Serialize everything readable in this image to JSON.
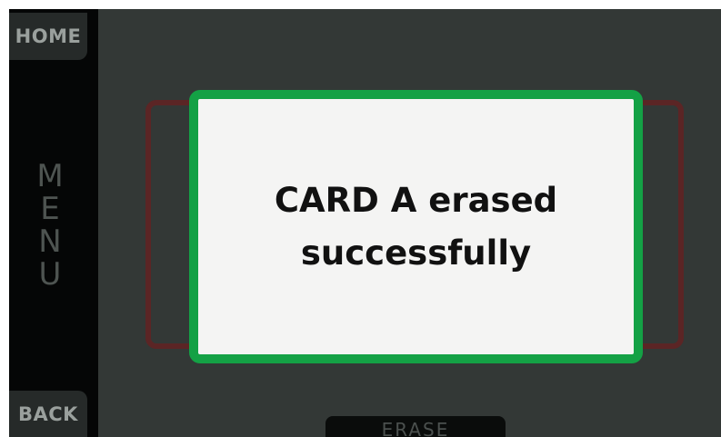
{
  "sidebar": {
    "home_label": "HOME",
    "menu_letters": [
      "M",
      "E",
      "N",
      "U"
    ],
    "back_label": "BACK"
  },
  "background": {
    "erase_label": "ERASE"
  },
  "dialog": {
    "line1": "CARD A erased",
    "line2": "successfully",
    "border_color": "#14a145"
  }
}
